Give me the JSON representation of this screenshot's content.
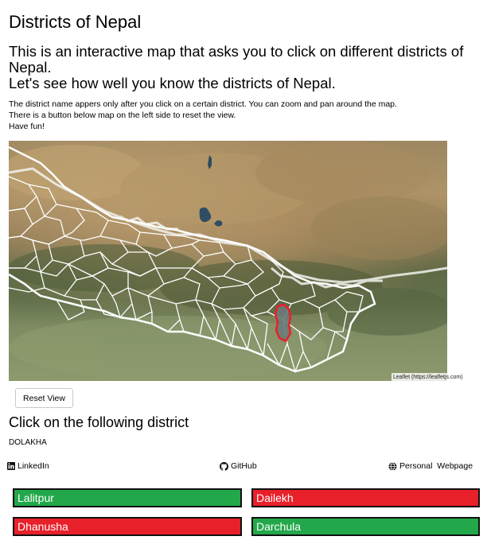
{
  "page": {
    "title": "Districts of Nepal",
    "intro_line1": "This is an interactive map that asks you to click on different districts of Nepal.",
    "intro_line2": "Let's see how well you know the districts of Nepal.",
    "note_line1": "The district name appers only after you click on a certain district. You can zoom and pan around the map.",
    "note_line2": "There is a button below map on the left side to reset the view.",
    "note_line3": "Have fun!"
  },
  "map": {
    "attribution": "Leaflet (https://leafletjs.com)",
    "border_color": "#ffffff",
    "highlight_color": "#e8202a"
  },
  "controls": {
    "reset_label": "Reset View"
  },
  "quiz": {
    "prompt": "Click on the following district",
    "target_district": "DOLAKHA"
  },
  "links": {
    "linkedin": "LinkedIn",
    "github": "GitHub",
    "webpage": "Personal  Webpage"
  },
  "answers": [
    {
      "label": "Lalitpur",
      "status": "correct",
      "color": "#22a84a"
    },
    {
      "label": "Dailekh",
      "status": "wrong",
      "color": "#e8202a"
    },
    {
      "label": "Dhanusha",
      "status": "wrong",
      "color": "#e8202a"
    },
    {
      "label": "Darchula",
      "status": "correct",
      "color": "#22a84a"
    }
  ]
}
